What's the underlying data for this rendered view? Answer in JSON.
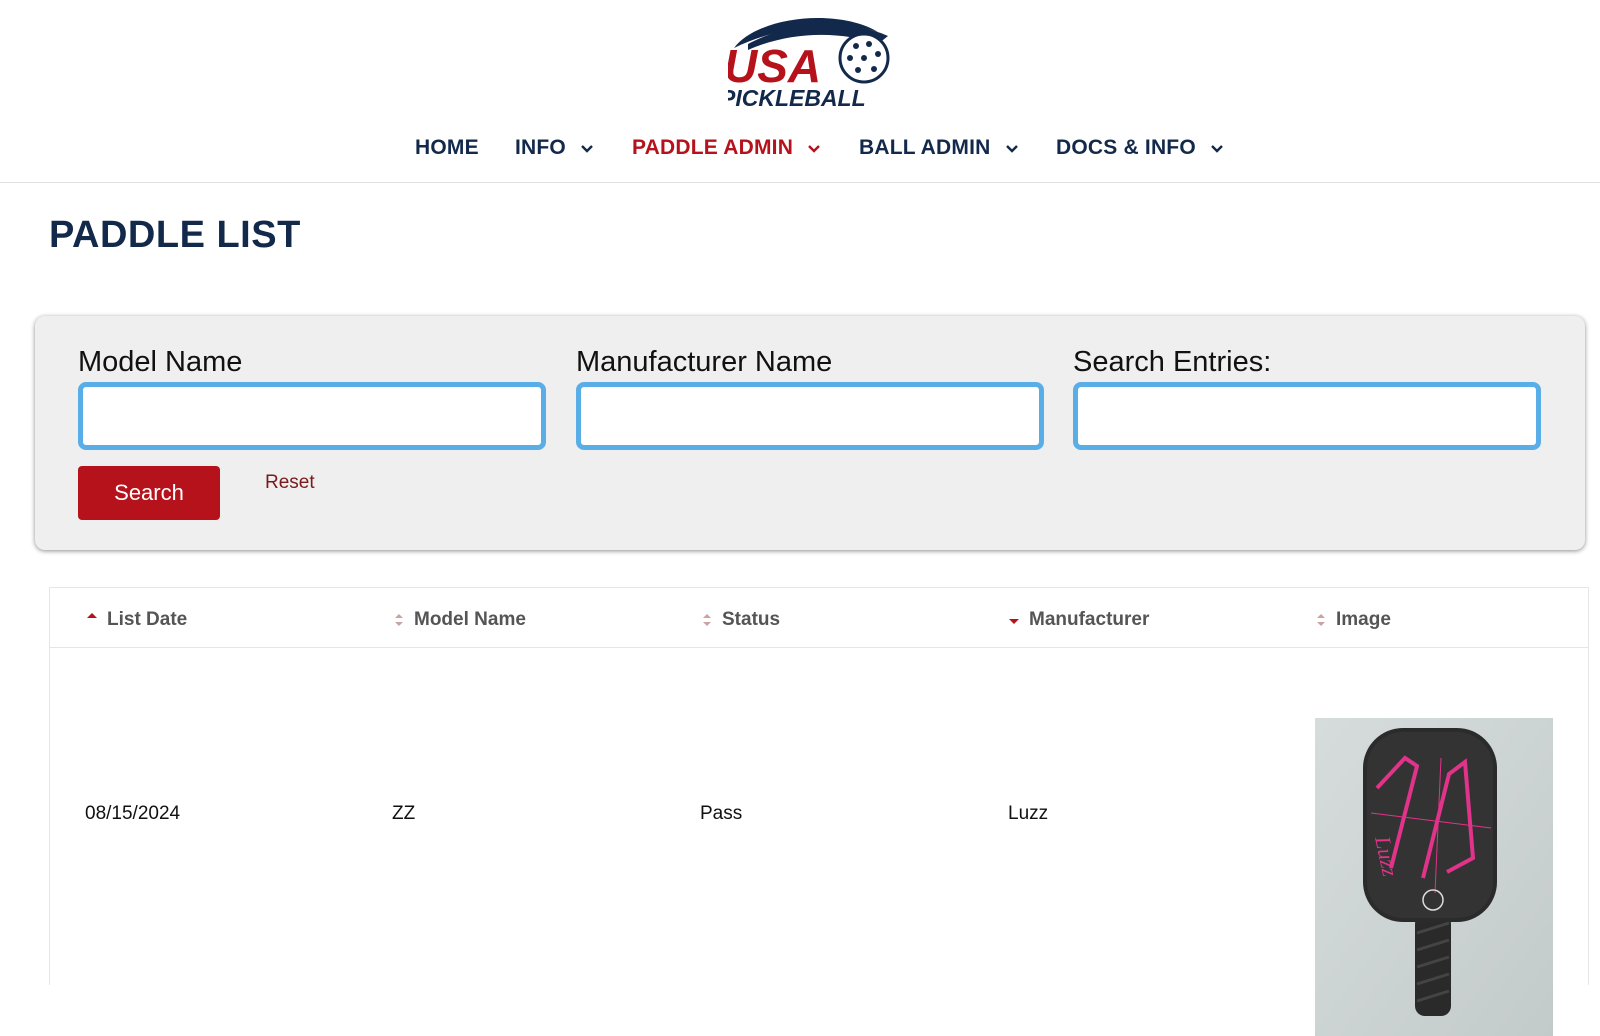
{
  "logo": {
    "line1": "USA",
    "line2": "PICKLEBALL",
    "brand_red": "#b5121b",
    "brand_navy": "#13294b"
  },
  "nav": {
    "items": [
      {
        "label": "HOME",
        "has_dropdown": false,
        "active": false
      },
      {
        "label": "INFO",
        "has_dropdown": true,
        "active": false
      },
      {
        "label": "PADDLE ADMIN",
        "has_dropdown": true,
        "active": true
      },
      {
        "label": "BALL ADMIN",
        "has_dropdown": true,
        "active": false
      },
      {
        "label": "DOCS & INFO",
        "has_dropdown": true,
        "active": false
      }
    ]
  },
  "page": {
    "title": "PADDLE LIST"
  },
  "search": {
    "model_label": "Model Name",
    "model_value": "",
    "manufacturer_label": "Manufacturer Name",
    "manufacturer_value": "",
    "entries_label": "Search Entries:",
    "entries_value": "",
    "search_button": "Search",
    "reset_link": "Reset"
  },
  "table": {
    "columns": [
      {
        "label": "List Date",
        "sort": "ascending"
      },
      {
        "label": "Model Name",
        "sort": "none"
      },
      {
        "label": "Status",
        "sort": "none"
      },
      {
        "label": "Manufacturer",
        "sort": "descending"
      },
      {
        "label": "Image",
        "sort": "none"
      }
    ],
    "rows": [
      {
        "list_date": "08/15/2024",
        "model_name": "ZZ",
        "status": "Pass",
        "manufacturer": "Luzz",
        "image": "paddle-photo",
        "paddle_text": "Luzz"
      }
    ]
  },
  "colors": {
    "accent_red": "#b5121b",
    "navy": "#13294b",
    "input_border": "#5aaee8",
    "panel_bg": "#efefef"
  }
}
